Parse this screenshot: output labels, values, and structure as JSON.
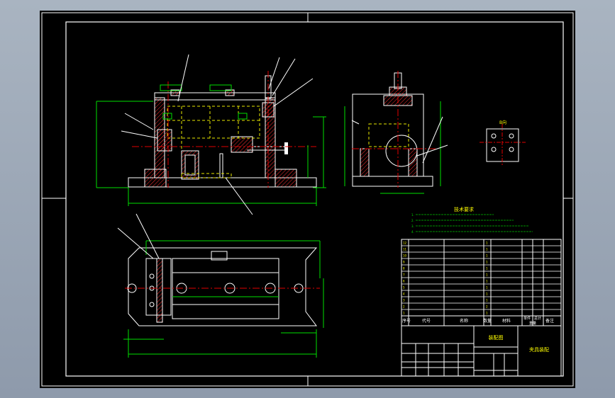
{
  "drawing": {
    "tech_requirements": {
      "title": "技术要求",
      "items": [
        "1.",
        "2.",
        "3.",
        "4."
      ]
    },
    "bom": {
      "header": {
        "seq": "序号",
        "code": "代号",
        "name": "名称",
        "qty": "数量",
        "material": "材料",
        "unit_weight": "单件",
        "total_weight": "总计",
        "weight": "重量",
        "remark": "备注"
      },
      "rows": [
        {
          "seq": "12",
          "qty": "1"
        },
        {
          "seq": "11",
          "qty": "1"
        },
        {
          "seq": "10",
          "qty": "1"
        },
        {
          "seq": "9",
          "qty": "1"
        },
        {
          "seq": "8",
          "qty": "1"
        },
        {
          "seq": "7",
          "qty": "1"
        },
        {
          "seq": "6",
          "qty": "1"
        },
        {
          "seq": "5",
          "qty": "1"
        },
        {
          "seq": "4",
          "qty": "1"
        },
        {
          "seq": "3",
          "qty": "1"
        },
        {
          "seq": "2",
          "qty": "2"
        },
        {
          "seq": "1",
          "qty": "1"
        }
      ]
    },
    "title_block": {
      "part_name": "装配图",
      "drawing_title": "夹具装配"
    },
    "view_labels": {
      "view_b": "B向"
    },
    "colors": {
      "sheet": "#000000",
      "outline": "#ffffff",
      "dimension": "#00e000",
      "center": "#e00000",
      "hidden": "#e8e800",
      "leader": "#ffffff",
      "label_text": "#ffff00"
    }
  }
}
